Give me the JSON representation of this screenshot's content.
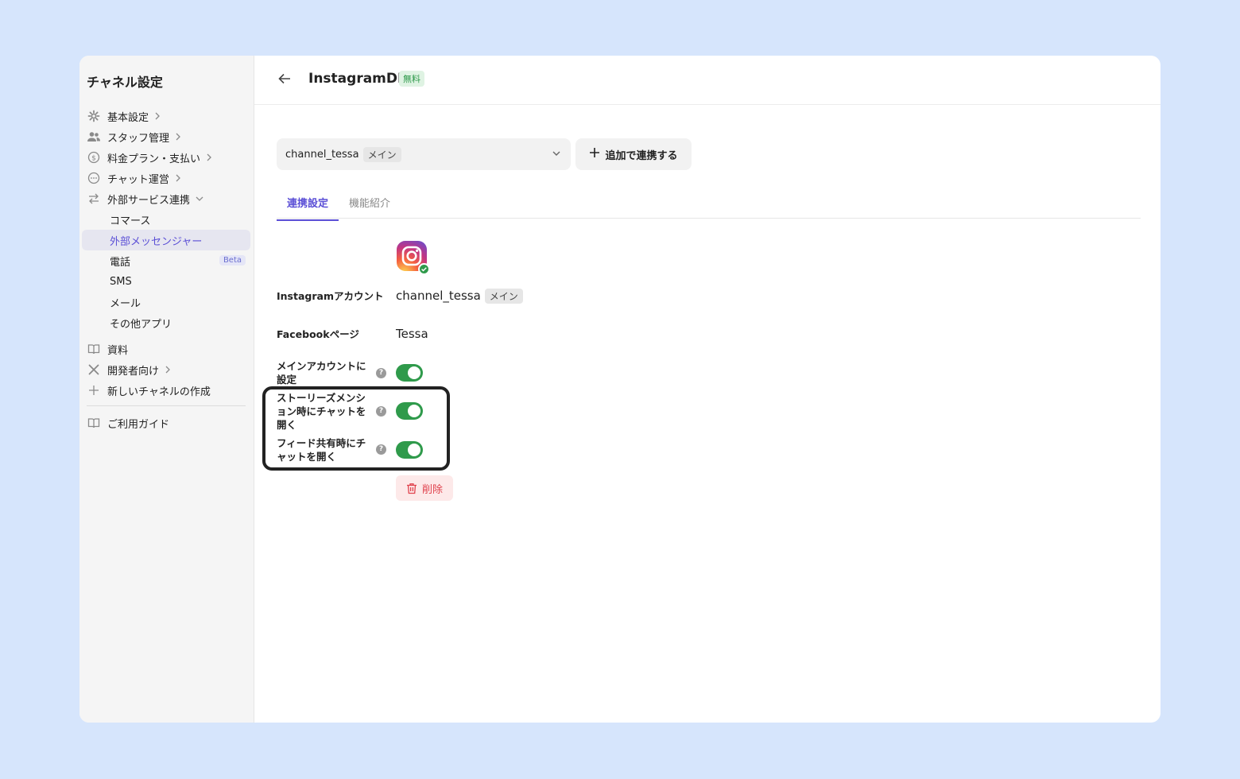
{
  "sidebar": {
    "title": "チャネル設定",
    "items": [
      {
        "label": "基本設定"
      },
      {
        "label": "スタッフ管理"
      },
      {
        "label": "料金プラン・支払い"
      },
      {
        "label": "チャット運営"
      },
      {
        "label": "外部サービス連携"
      }
    ],
    "subitems": [
      {
        "label": "コマース"
      },
      {
        "label": "外部メッセンジャー"
      },
      {
        "label": "電話",
        "badge": "Beta"
      },
      {
        "label": "SMS"
      },
      {
        "label": "メール"
      },
      {
        "label": "その他アプリ"
      }
    ],
    "lower_items": [
      {
        "label": "資料"
      },
      {
        "label": "開発者向け"
      },
      {
        "label": "新しいチャネルの作成"
      }
    ],
    "guide": {
      "label": "ご利用ガイド"
    }
  },
  "header": {
    "title": "InstagramDM",
    "badge": "無料"
  },
  "account_select": {
    "value": "channel_tessa",
    "tag": "メイン"
  },
  "add_button": {
    "label": "追加で連携する"
  },
  "tabs": [
    {
      "label": "連携設定",
      "active": true
    },
    {
      "label": "機能紹介",
      "active": false
    }
  ],
  "details": {
    "instagram_label": "Instagramアカウント",
    "instagram_value": "channel_tessa",
    "instagram_tag": "メイン",
    "facebook_label": "Facebookページ",
    "facebook_value": "Tessa",
    "toggles": [
      {
        "label": "メインアカウントに設定",
        "on": true
      },
      {
        "label": "ストーリーズメンション時にチャットを開く",
        "on": true
      },
      {
        "label": "フィード共有時にチャットを開く",
        "on": true
      }
    ],
    "help_glyph": "?"
  },
  "delete_button": {
    "label": "削除"
  },
  "colors": {
    "accent": "#5b4fd6",
    "toggle_on": "#2f9a4b",
    "danger": "#e0424d",
    "background": "#d6e5fc"
  }
}
